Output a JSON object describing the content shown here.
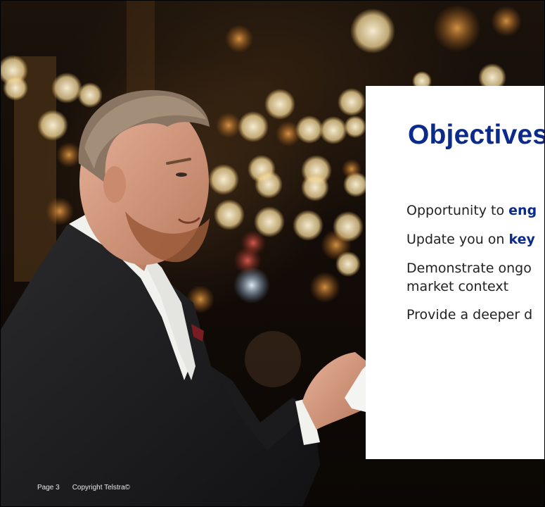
{
  "slide": {
    "title": "Objectives",
    "objectives": [
      {
        "prefix": "Opportunity to ",
        "highlight": "eng"
      },
      {
        "prefix": "Update you on ",
        "highlight": "key"
      },
      {
        "line1": "Demonstrate ongo",
        "line2": "market context"
      },
      {
        "text": "Provide a deeper d"
      }
    ],
    "footer": {
      "page": "Page 3",
      "copyright": "Copyright Telstra©"
    }
  },
  "colors": {
    "title": "#0a2a8c",
    "highlight": "#0a2a8c",
    "body_text": "#222222",
    "card": "#ffffff"
  }
}
